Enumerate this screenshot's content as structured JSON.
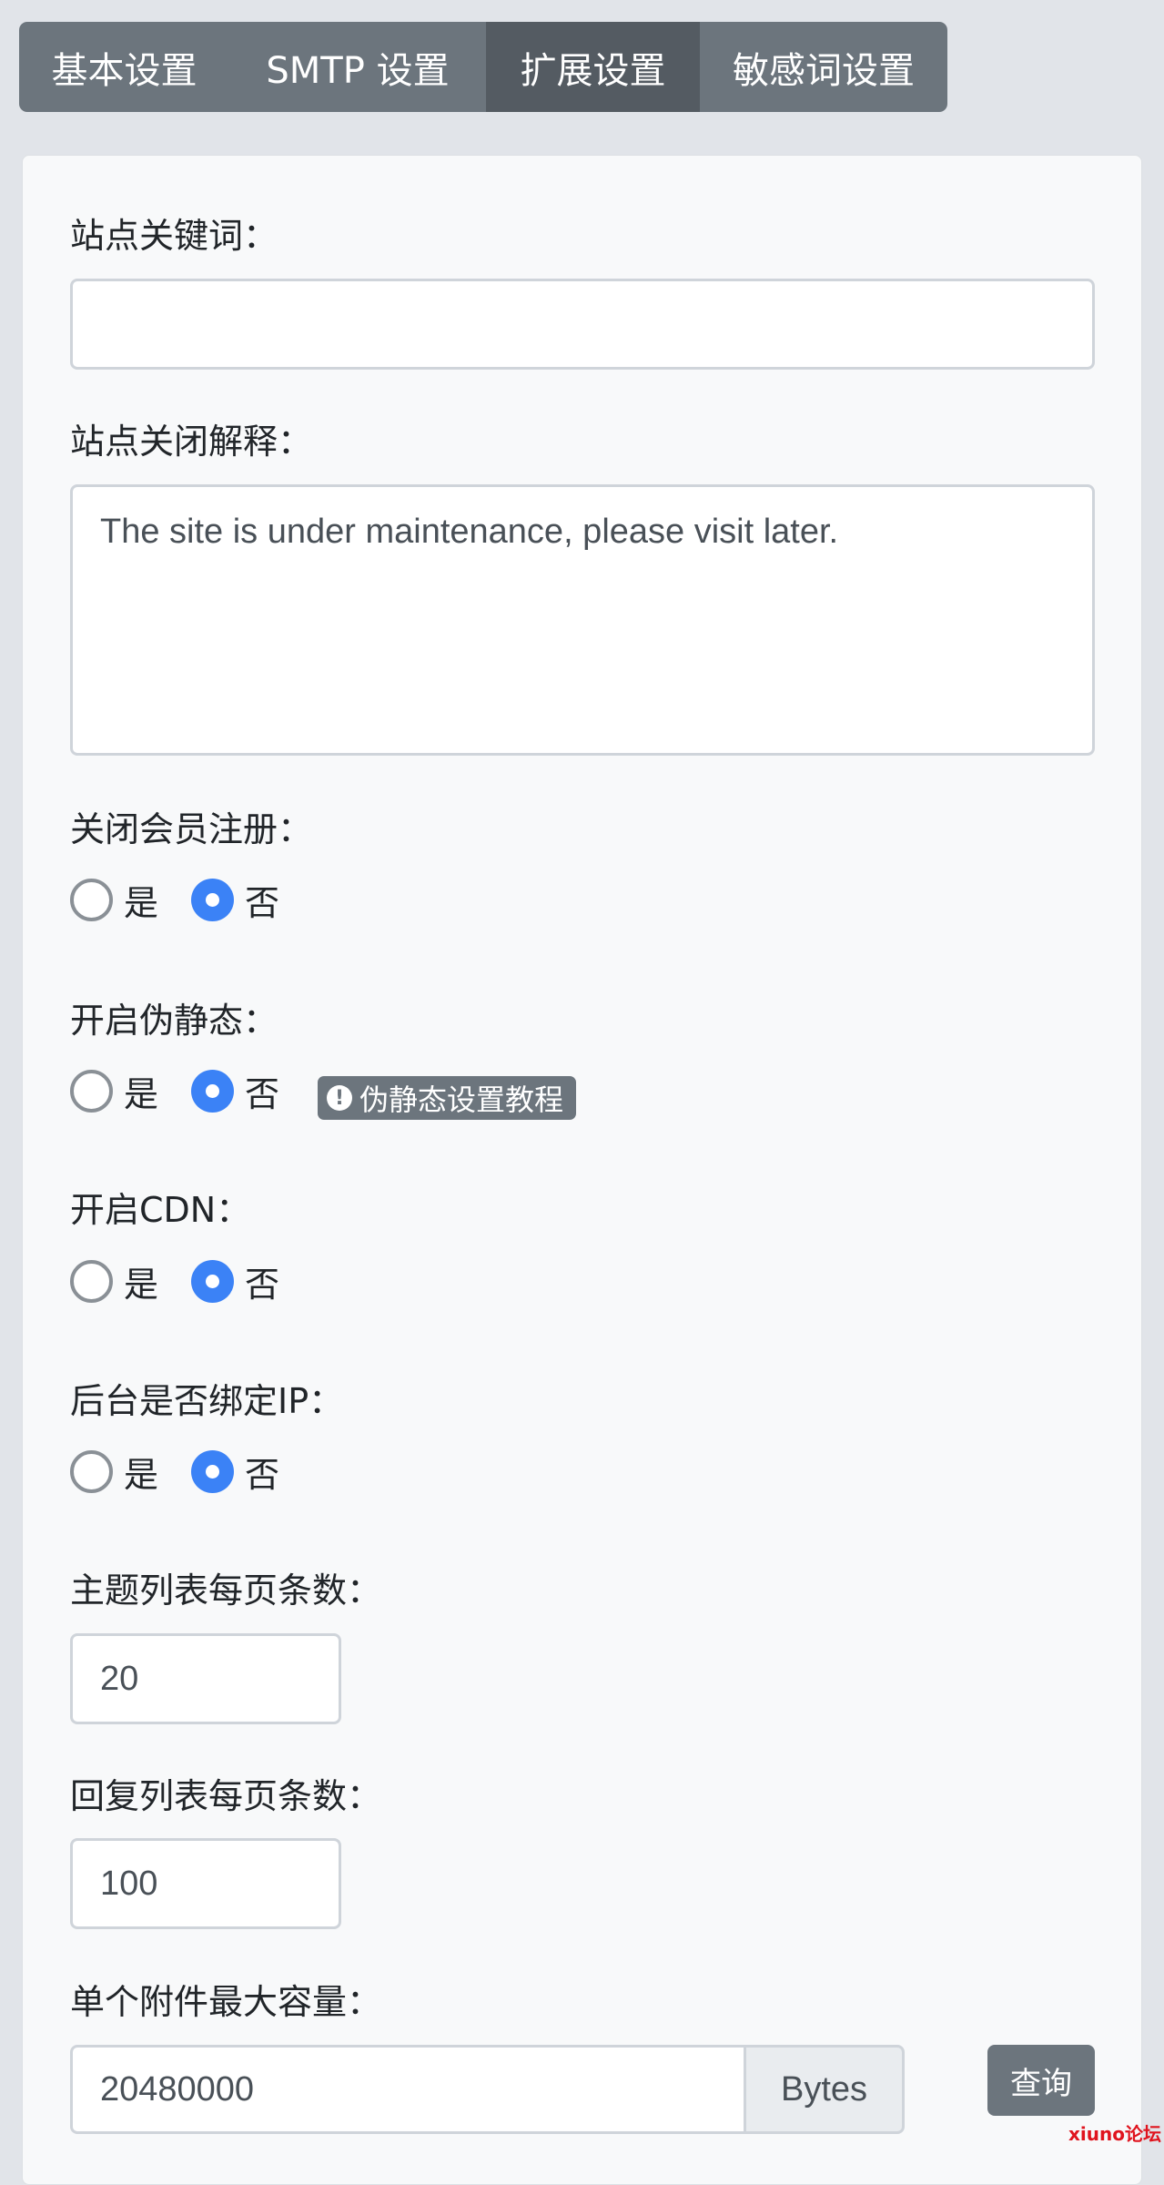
{
  "tabs": [
    {
      "label": "基本设置",
      "active": false
    },
    {
      "label": "SMTP 设置",
      "active": false
    },
    {
      "label": "扩展设置",
      "active": true
    },
    {
      "label": "敏感词设置",
      "active": false
    }
  ],
  "form": {
    "site_keywords": {
      "label": "站点关键词：",
      "value": ""
    },
    "close_reason": {
      "label": "站点关闭解释：",
      "value": "The site is under maintenance, please visit later."
    },
    "close_registration": {
      "label": "关闭会员注册：",
      "yes": "是",
      "no": "否",
      "selected": "no"
    },
    "pseudo_static": {
      "label": "开启伪静态：",
      "yes": "是",
      "no": "否",
      "selected": "no",
      "badge": "伪静态设置教程"
    },
    "cdn": {
      "label": "开启CDN：",
      "yes": "是",
      "no": "否",
      "selected": "no"
    },
    "bind_ip": {
      "label": "后台是否绑定IP：",
      "yes": "是",
      "no": "否",
      "selected": "no"
    },
    "threads_per_page": {
      "label": "主题列表每页条数：",
      "value": "20"
    },
    "replies_per_page": {
      "label": "回复列表每页条数：",
      "value": "100"
    },
    "max_attachment": {
      "label": "单个附件最大容量：",
      "value": "20480000",
      "unit": "Bytes",
      "query_button": "查询"
    }
  },
  "watermark": "xiuno论坛",
  "colors": {
    "tab_bg": "#6c757d",
    "tab_active_bg": "#545b62",
    "radio_checked": "#3b82f6",
    "watermark": "#e0141e"
  }
}
